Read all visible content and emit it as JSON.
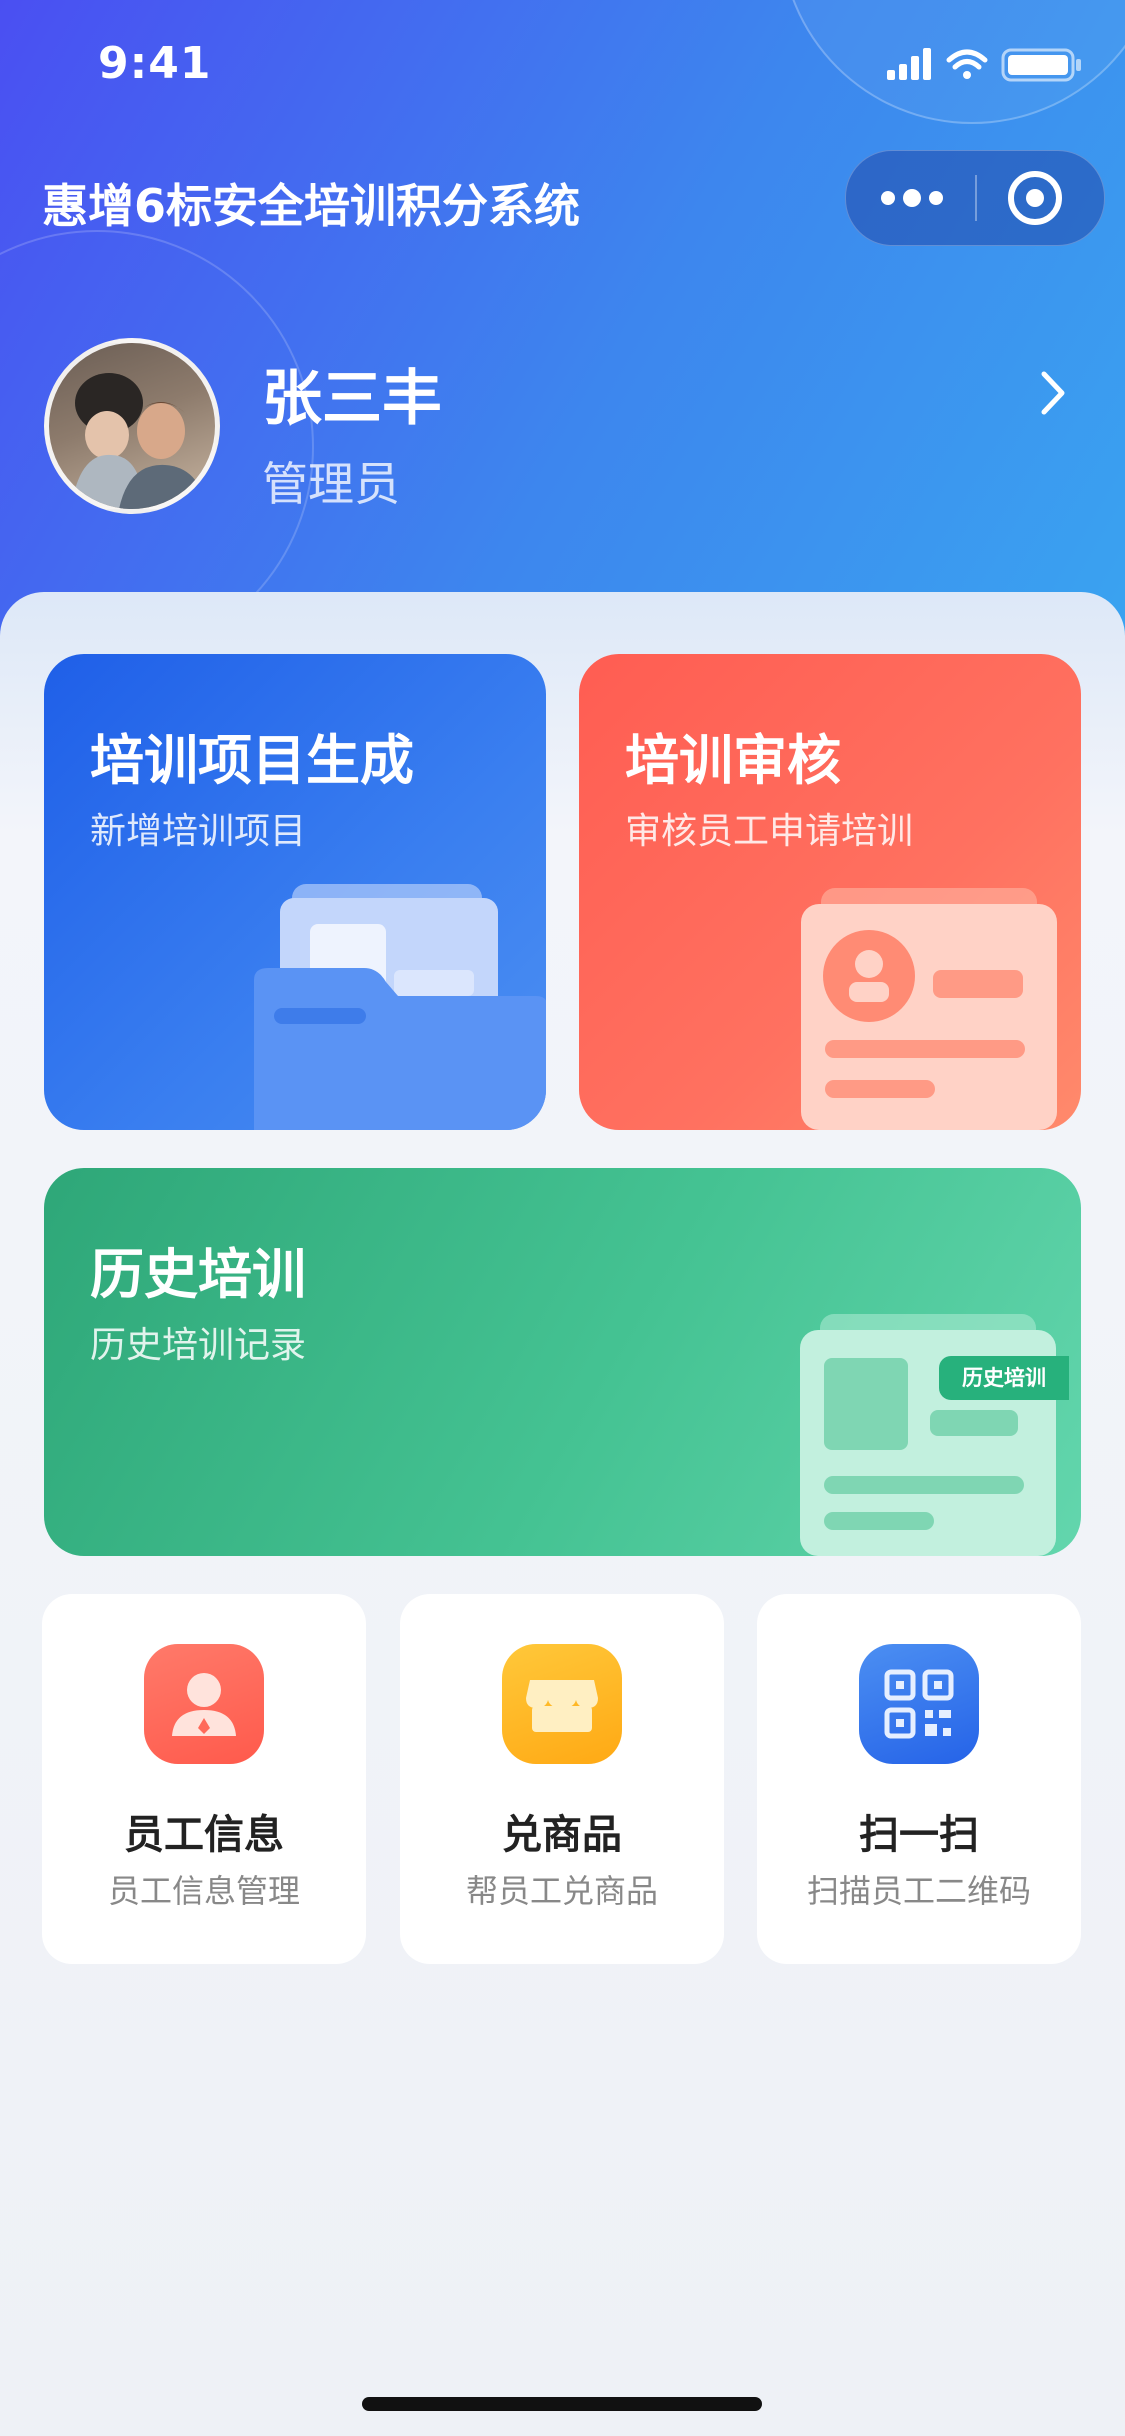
{
  "status_bar": {
    "time": "9:41"
  },
  "app": {
    "title": "惠增6标安全培训积分系统"
  },
  "icons": {
    "signal": "signal-icon",
    "wifi": "wifi-icon",
    "battery": "battery-icon",
    "more": "more-dots-icon",
    "close": "close-target-icon",
    "chevron": "chevron-right-icon"
  },
  "profile": {
    "name": "张三丰",
    "role": "管理员"
  },
  "cards": {
    "create": {
      "title": "培训项目生成",
      "subtitle": "新增培训项目",
      "color": "#2f73ef"
    },
    "review": {
      "title": "培训审核",
      "subtitle": "审核员工申请培训",
      "color": "#ff6b5b"
    },
    "history": {
      "title": "历史培训",
      "subtitle": "历史培训记录",
      "badge": "历史培训",
      "color": "#3bbf8e"
    }
  },
  "tiles": [
    {
      "label": "员工信息",
      "subtitle": "员工信息管理",
      "icon": "user-icon"
    },
    {
      "label": "兑商品",
      "subtitle": "帮员工兑商品",
      "icon": "store-icon"
    },
    {
      "label": "扫一扫",
      "subtitle": "扫描员工二维码",
      "icon": "qr-scan-icon"
    }
  ]
}
